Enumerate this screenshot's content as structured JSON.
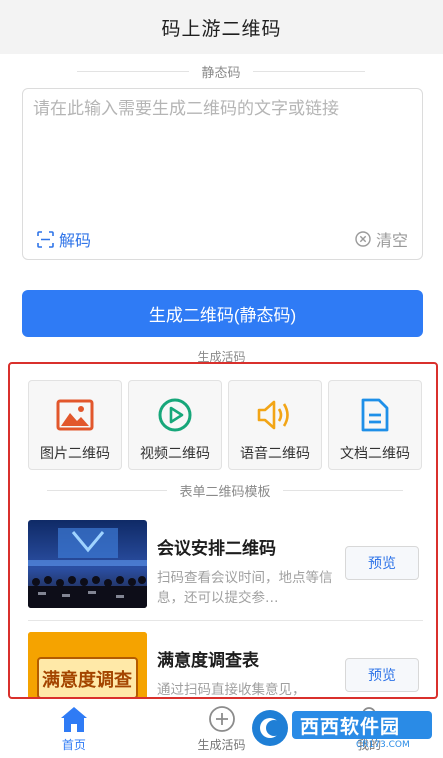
{
  "header": {
    "title": "码上游二维码"
  },
  "static_section": {
    "label": "静态码"
  },
  "text_input": {
    "placeholder": "请在此输入需要生成二维码的文字或链接",
    "value": ""
  },
  "actions": {
    "decode_label": "解码",
    "clear_label": "清空"
  },
  "generate_button": {
    "label": "生成二维码(静态码)"
  },
  "live_section": {
    "label": "生成活码"
  },
  "types": [
    {
      "label": "图片二维码",
      "icon": "image-icon",
      "color": "#e2572c"
    },
    {
      "label": "视频二维码",
      "icon": "video-icon",
      "color": "#17a77a"
    },
    {
      "label": "语音二维码",
      "icon": "audio-icon",
      "color": "#f2a516"
    },
    {
      "label": "文档二维码",
      "icon": "document-icon",
      "color": "#1e8fe8"
    }
  ],
  "form_section": {
    "label": "表单二维码模板"
  },
  "templates": [
    {
      "title": "会议安排二维码",
      "desc": "扫码查看会议时间，地点等信息，还可以提交参…",
      "action": "预览"
    },
    {
      "title": "满意度调查表",
      "desc": "通过扫码直接收集意见，",
      "action": "预览",
      "thumb_text": "满意度调查"
    }
  ],
  "tabbar": {
    "items": [
      {
        "label": "首页",
        "icon": "home-icon",
        "active": true
      },
      {
        "label": "生成活码",
        "icon": "plus-circle-icon",
        "active": false
      },
      {
        "label": "我的",
        "icon": "user-icon",
        "active": false
      }
    ]
  },
  "watermark": {
    "text": "西西软件园",
    "sub": "CR173.COM"
  },
  "colors": {
    "accent": "#2f7bf5",
    "highlight_border": "#d9302c"
  }
}
